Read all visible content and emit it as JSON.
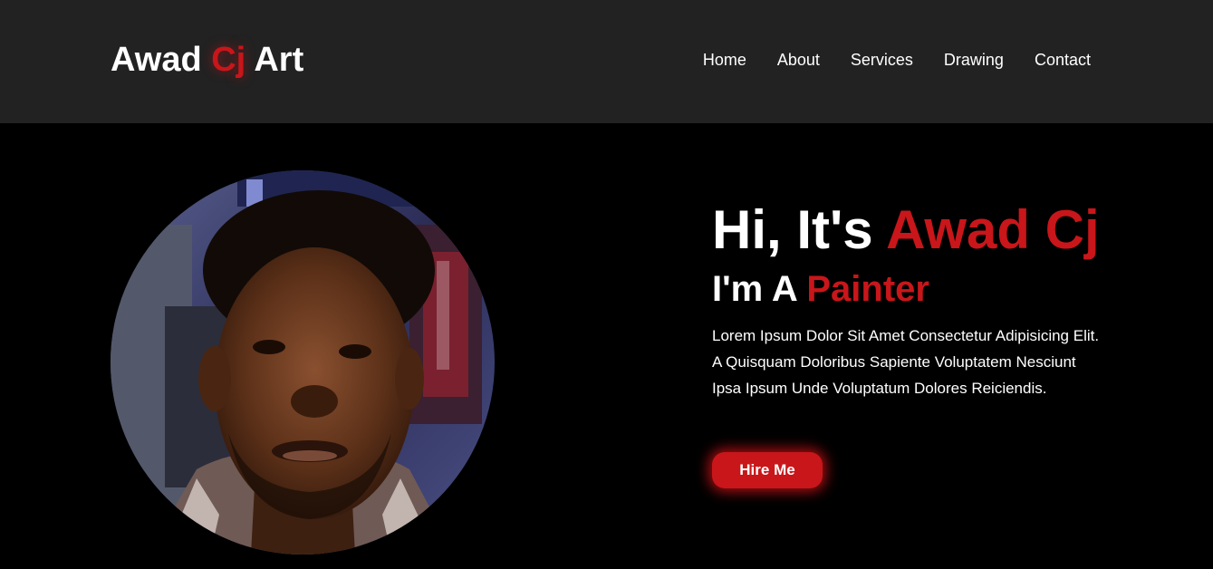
{
  "brand": {
    "part1": "Awad ",
    "part2": "Cj",
    "part3": " Art",
    "accent_color": "#c8161a"
  },
  "nav": {
    "items": [
      "Home",
      "About",
      "Services",
      "Drawing",
      "Contact"
    ]
  },
  "hero": {
    "greeting_prefix": "Hi, It's ",
    "greeting_name": "Awad Cj",
    "role_prefix": "I'm A ",
    "role": "Painter",
    "description": "Lorem Ipsum Dolor Sit Amet Consectetur Adipisicing Elit. A Quisquam Doloribus Sapiente Voluptatem Nesciunt Ipsa Ipsum Unde Voluptatum Dolores Reiciendis.",
    "cta_label": "Hire Me",
    "portrait_icon": "profile-photo"
  },
  "colors": {
    "header_bg": "#222222",
    "page_bg": "#000000",
    "accent": "#c8161a"
  }
}
